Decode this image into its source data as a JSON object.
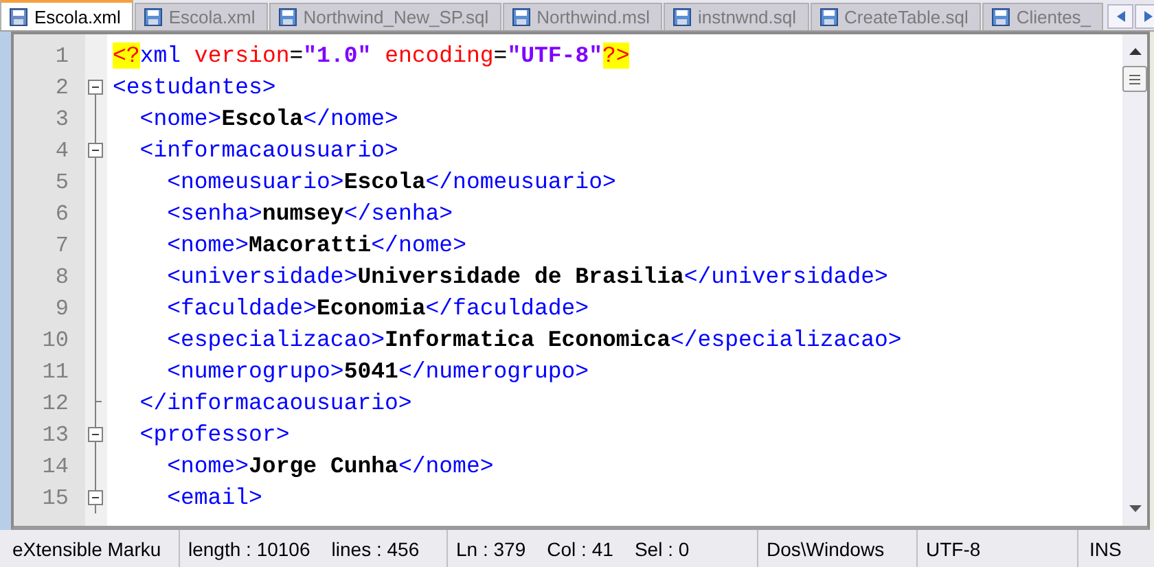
{
  "tabs": [
    {
      "label": "Escola.xml",
      "selected": true
    },
    {
      "label": "Escola.xml",
      "selected": false
    },
    {
      "label": "Northwind_New_SP.sql",
      "selected": false
    },
    {
      "label": "Northwind.msl",
      "selected": false
    },
    {
      "label": "instnwnd.sql",
      "selected": false
    },
    {
      "label": "CreateTable.sql",
      "selected": false
    },
    {
      "label": "Clientes_",
      "selected": false
    }
  ],
  "editor": {
    "lines": [
      {
        "number": "1",
        "collapsible": false,
        "block_end": false,
        "tokens": [
          {
            "kind": "decl",
            "text": "<?"
          },
          {
            "kind": "tag",
            "text": "xml"
          },
          {
            "kind": "attr",
            "text": " version"
          },
          {
            "kind": "eq",
            "text": "="
          },
          {
            "kind": "value",
            "text": "\"1.0\""
          },
          {
            "kind": "attr",
            "text": " encoding"
          },
          {
            "kind": "eq",
            "text": "="
          },
          {
            "kind": "value",
            "text": "\"UTF-8\""
          },
          {
            "kind": "decl",
            "text": "?>"
          }
        ]
      },
      {
        "number": "2",
        "collapsible": true,
        "block_end": false,
        "tokens": [
          {
            "kind": "tag",
            "text": "<estudantes>"
          }
        ]
      },
      {
        "number": "3",
        "collapsible": false,
        "block_end": false,
        "tokens": [
          {
            "kind": "tag",
            "text": "  <nome>"
          },
          {
            "kind": "text",
            "text": "Escola"
          },
          {
            "kind": "tag",
            "text": "</nome>"
          }
        ]
      },
      {
        "number": "4",
        "collapsible": true,
        "block_end": false,
        "tokens": [
          {
            "kind": "tag",
            "text": "  <informacaousuario>"
          }
        ]
      },
      {
        "number": "5",
        "collapsible": false,
        "block_end": false,
        "tokens": [
          {
            "kind": "tag",
            "text": "    <nomeusuario>"
          },
          {
            "kind": "text",
            "text": "Escola"
          },
          {
            "kind": "tag",
            "text": "</nomeusuario>"
          }
        ]
      },
      {
        "number": "6",
        "collapsible": false,
        "block_end": false,
        "tokens": [
          {
            "kind": "tag",
            "text": "    <senha>"
          },
          {
            "kind": "text",
            "text": "numsey"
          },
          {
            "kind": "tag",
            "text": "</senha>"
          }
        ]
      },
      {
        "number": "7",
        "collapsible": false,
        "block_end": false,
        "tokens": [
          {
            "kind": "tag",
            "text": "    <nome>"
          },
          {
            "kind": "text",
            "text": "Macoratti"
          },
          {
            "kind": "tag",
            "text": "</nome>"
          }
        ]
      },
      {
        "number": "8",
        "collapsible": false,
        "block_end": false,
        "tokens": [
          {
            "kind": "tag",
            "text": "    <universidade>"
          },
          {
            "kind": "text",
            "text": "Universidade de Brasilia"
          },
          {
            "kind": "tag",
            "text": "</universidade>"
          }
        ]
      },
      {
        "number": "9",
        "collapsible": false,
        "block_end": false,
        "tokens": [
          {
            "kind": "tag",
            "text": "    <faculdade>"
          },
          {
            "kind": "text",
            "text": "Economia"
          },
          {
            "kind": "tag",
            "text": "</faculdade>"
          }
        ]
      },
      {
        "number": "10",
        "collapsible": false,
        "block_end": false,
        "tokens": [
          {
            "kind": "tag",
            "text": "    <especializacao>"
          },
          {
            "kind": "text",
            "text": "Informatica Economica"
          },
          {
            "kind": "tag",
            "text": "</especializacao>"
          }
        ]
      },
      {
        "number": "11",
        "collapsible": false,
        "block_end": false,
        "tokens": [
          {
            "kind": "tag",
            "text": "    <numerogrupo>"
          },
          {
            "kind": "text",
            "text": "5041"
          },
          {
            "kind": "tag",
            "text": "</numerogrupo>"
          }
        ]
      },
      {
        "number": "12",
        "collapsible": false,
        "block_end": true,
        "tokens": [
          {
            "kind": "tag",
            "text": "  </informacaousuario>"
          }
        ]
      },
      {
        "number": "13",
        "collapsible": true,
        "block_end": false,
        "tokens": [
          {
            "kind": "tag",
            "text": "  <professor>"
          }
        ]
      },
      {
        "number": "14",
        "collapsible": false,
        "block_end": false,
        "tokens": [
          {
            "kind": "tag",
            "text": "    <nome>"
          },
          {
            "kind": "text",
            "text": "Jorge Cunha"
          },
          {
            "kind": "tag",
            "text": "</nome>"
          }
        ]
      },
      {
        "number": "15",
        "collapsible": true,
        "block_end": false,
        "tokens": [
          {
            "kind": "tag",
            "text": "    <email>"
          }
        ]
      }
    ]
  },
  "status_bar": {
    "cells": [
      {
        "text": "eXtensible Marku"
      },
      {
        "text": "length : 10106    lines : 456"
      },
      {
        "text": "Ln : 379    Col : 41    Sel : 0"
      },
      {
        "text": "Dos\\Windows"
      },
      {
        "text": "UTF-8"
      },
      {
        "text": "INS"
      }
    ]
  }
}
